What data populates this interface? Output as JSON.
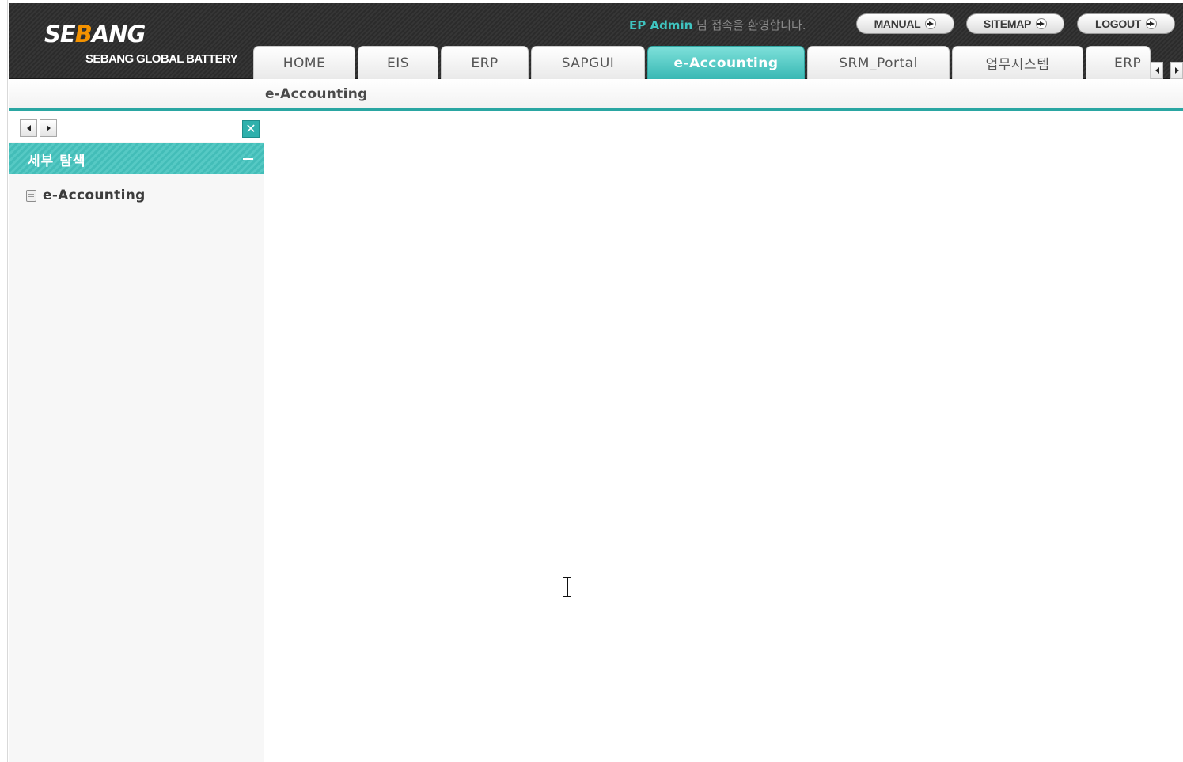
{
  "header": {
    "logo_text_part1": "SE",
    "logo_text_part2": "B",
    "logo_text_part3": "ANG",
    "logo_subtitle": "SEBANG GLOBAL BATTERY",
    "welcome_user": "EP Admin",
    "welcome_suffix": " 님 접속을 환영합니다.",
    "buttons": {
      "manual": "MANUAL",
      "sitemap": "SITEMAP",
      "logout": "LOGOUT"
    }
  },
  "tabs": [
    {
      "label": "HOME",
      "active": false
    },
    {
      "label": "EIS",
      "active": false
    },
    {
      "label": "ERP",
      "active": false
    },
    {
      "label": "SAPGUI",
      "active": false
    },
    {
      "label": "e-Accounting",
      "active": true
    },
    {
      "label": "SRM_Portal",
      "active": false
    },
    {
      "label": "업무시스템",
      "active": false
    },
    {
      "label": "ERP",
      "active": false
    }
  ],
  "breadcrumb": "e-Accounting",
  "left_panel": {
    "section_title": "세부 탐색",
    "tree_items": [
      {
        "label": "e-Accounting",
        "icon": "document-icon"
      }
    ]
  },
  "colors": {
    "accent": "#38b8b4",
    "header_bg": "#2f2f2f",
    "logo_orange": "#f39200",
    "welcome_name": "#3fc4c0"
  }
}
